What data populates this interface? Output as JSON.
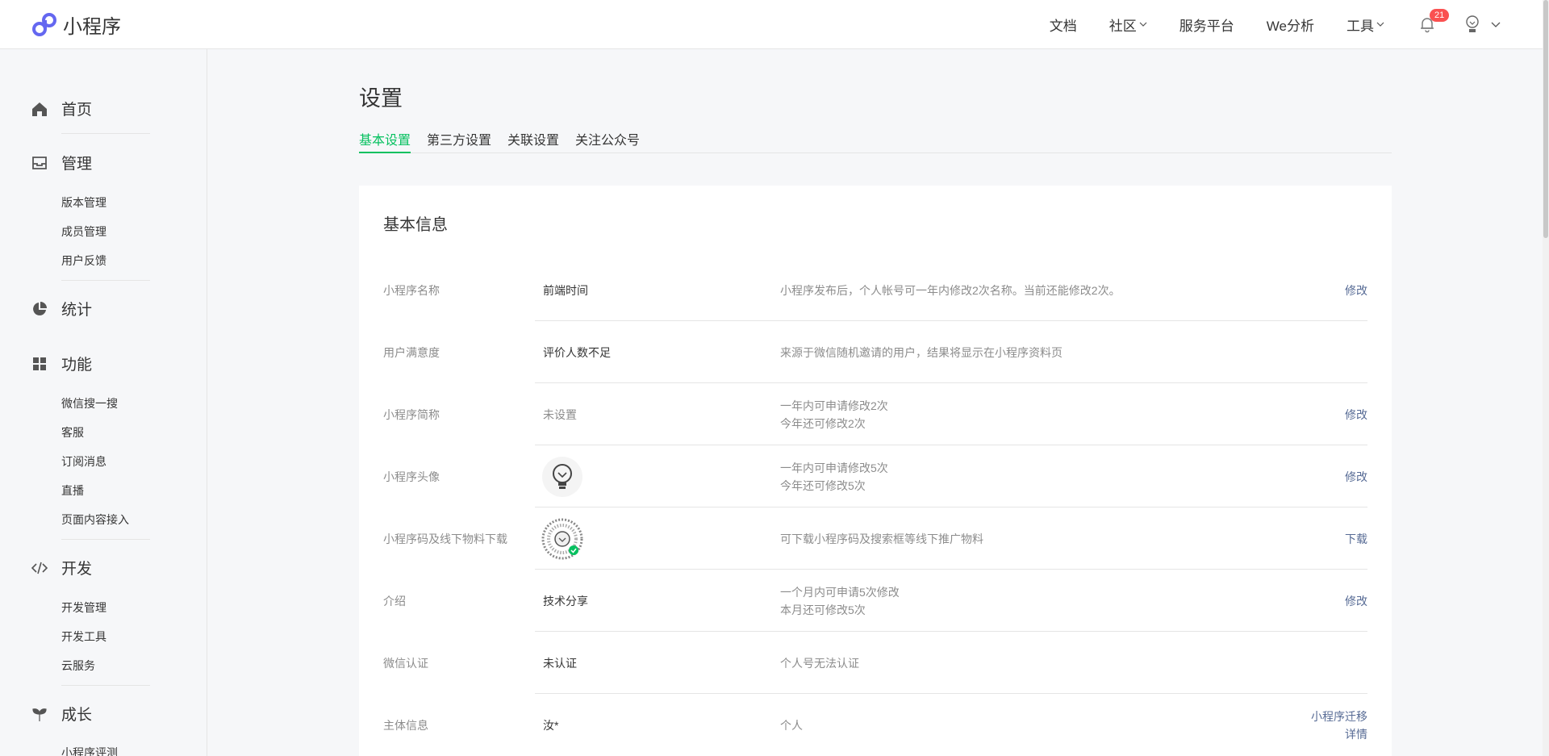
{
  "app": {
    "title": "小程序"
  },
  "nav": {
    "docs": "文档",
    "community": "社区",
    "service": "服务平台",
    "analytics": "We分析",
    "tools": "工具",
    "notifications": "21"
  },
  "sidebar": {
    "home": "首页",
    "manage": "管理",
    "manage_items": [
      "版本管理",
      "成员管理",
      "用户反馈"
    ],
    "stats": "统计",
    "features": "功能",
    "feature_items": [
      "微信搜一搜",
      "客服",
      "订阅消息",
      "直播",
      "页面内容接入"
    ],
    "develop": "开发",
    "develop_items": [
      "开发管理",
      "开发工具",
      "云服务"
    ],
    "growth": "成长",
    "growth_items": [
      "小程序评测"
    ]
  },
  "page": {
    "title": "设置",
    "tabs": [
      "基本设置",
      "第三方设置",
      "关联设置",
      "关注公众号"
    ]
  },
  "card": {
    "title": "基本信息",
    "rows": [
      {
        "label": "小程序名称",
        "value": "前端时间",
        "desc1": "小程序发布后，个人帐号可一年内修改2次名称。当前还能修改2次。",
        "action": "修改"
      },
      {
        "label": "用户满意度",
        "value": "评价人数不足",
        "desc1": "来源于微信随机邀请的用户，结果将显示在小程序资料页"
      },
      {
        "label": "小程序简称",
        "value": "未设置",
        "desc1": "一年内可申请修改2次",
        "desc2": "今年还可修改2次",
        "action": "修改"
      },
      {
        "label": "小程序头像",
        "desc1": "一年内可申请修改5次",
        "desc2": "今年还可修改5次",
        "action": "修改"
      },
      {
        "label": "小程序码及线下物料下载",
        "desc1": "可下载小程序码及搜索框等线下推广物料",
        "action": "下载"
      },
      {
        "label": "介绍",
        "value": "技术分享",
        "desc1": "一个月内可申请5次修改",
        "desc2": "本月还可修改5次",
        "action": "修改"
      },
      {
        "label": "微信认证",
        "value": "未认证",
        "desc1": "个人号无法认证"
      },
      {
        "label": "主体信息",
        "value": "汝*",
        "desc1": "个人",
        "action": "小程序迁移",
        "action2": "详情"
      }
    ]
  }
}
